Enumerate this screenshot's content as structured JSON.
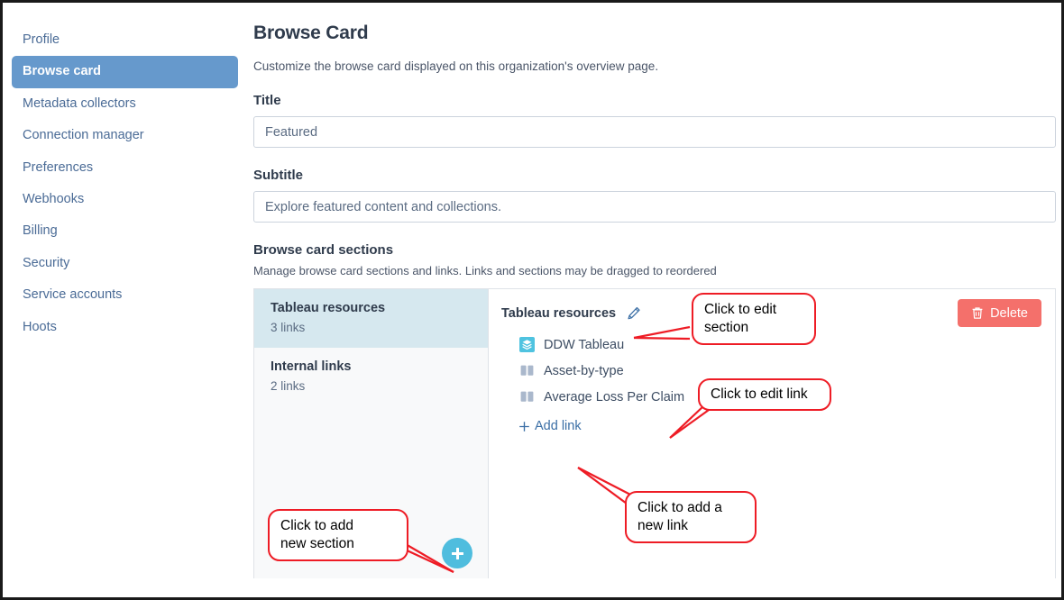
{
  "sidebar": {
    "items": [
      {
        "label": "Profile",
        "active": false
      },
      {
        "label": "Browse card",
        "active": true
      },
      {
        "label": "Metadata collectors",
        "active": false
      },
      {
        "label": "Connection manager",
        "active": false
      },
      {
        "label": "Preferences",
        "active": false
      },
      {
        "label": "Webhooks",
        "active": false
      },
      {
        "label": "Billing",
        "active": false
      },
      {
        "label": "Security",
        "active": false
      },
      {
        "label": "Service accounts",
        "active": false
      },
      {
        "label": "Hoots",
        "active": false
      }
    ]
  },
  "page": {
    "title": "Browse Card",
    "description": "Customize the browse card displayed on this organization's overview page."
  },
  "form": {
    "title_label": "Title",
    "title_value": "Featured",
    "title_placeholder": "Featured",
    "subtitle_label": "Subtitle",
    "subtitle_value": "Explore featured content and collections.",
    "subtitle_placeholder": "Explore featured content and collections."
  },
  "sections_block": {
    "heading": "Browse card sections",
    "description": "Manage browse card sections and links. Links and sections may be dragged to reordered"
  },
  "sections": [
    {
      "name": "Tableau resources",
      "count": "3 links",
      "selected": true
    },
    {
      "name": "Internal links",
      "count": "2 links",
      "selected": false
    }
  ],
  "detail": {
    "section_title": "Tableau resources",
    "edit_icon": "pencil-icon",
    "delete_label": "Delete",
    "delete_icon": "trash-icon",
    "delete_color": "#f4706b",
    "add_link_label": "Add link",
    "add_link_icon": "plus-icon",
    "links": [
      {
        "label": "DDW Tableau",
        "icon": "tableau-layers-icon"
      },
      {
        "label": "Asset-by-type",
        "icon": "book-icon"
      },
      {
        "label": "Average Loss Per Claim",
        "icon": "book-icon"
      }
    ]
  },
  "fab": {
    "icon": "plus-icon",
    "color": "#4fbdde"
  },
  "annotations": [
    {
      "text": "Click to edit\nsection"
    },
    {
      "text": "Click to edit link"
    },
    {
      "text": "Click to add a\nnew link"
    },
    {
      "text": "Click to add\nnew section"
    }
  ],
  "colors": {
    "accent_blue": "#6699cc",
    "selected_section": "#d6e8ef",
    "annotation_red": "#ee1c25",
    "link_blue": "#3a6ea5"
  }
}
